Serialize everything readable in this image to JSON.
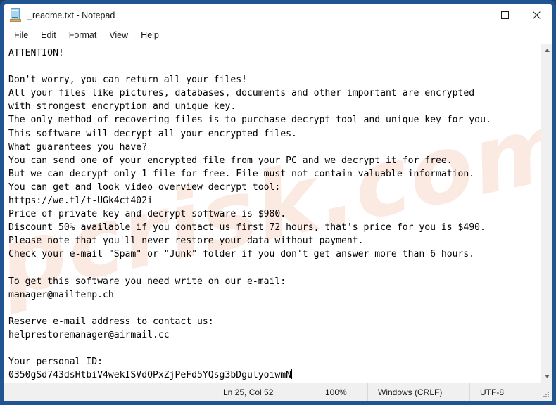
{
  "window": {
    "title": "_readme.txt - Notepad",
    "icon": "notepad-icon",
    "controls": {
      "minimize": "Minimize",
      "maximize": "Maximize",
      "close": "Close"
    },
    "border_color": "#205493"
  },
  "menu": {
    "items": [
      {
        "label": "File"
      },
      {
        "label": "Edit"
      },
      {
        "label": "Format"
      },
      {
        "label": "View"
      },
      {
        "label": "Help"
      }
    ]
  },
  "editor": {
    "watermark": "pcrisk.com",
    "content": "ATTENTION!\n\nDon't worry, you can return all your files!\nAll your files like pictures, databases, documents and other important are encrypted\nwith strongest encryption and unique key.\nThe only method of recovering files is to purchase decrypt tool and unique key for you.\nThis software will decrypt all your encrypted files.\nWhat guarantees you have?\nYou can send one of your encrypted file from your PC and we decrypt it for free.\nBut we can decrypt only 1 file for free. File must not contain valuable information.\nYou can get and look video overview decrypt tool:\nhttps://we.tl/t-UGk4ct402i\nPrice of private key and decrypt software is $980.\nDiscount 50% available if you contact us first 72 hours, that's price for you is $490.\nPlease note that you'll never restore your data without payment.\nCheck your e-mail \"Spam\" or \"Junk\" folder if you don't get answer more than 6 hours.\n\nTo get this software you need write on our e-mail:\nmanager@mailtemp.ch\n\nReserve e-mail address to contact us:\nhelprestoremanager@airmail.cc\n\nYour personal ID:\n0350gSd743dsHtbiV4wekISVdQPxZjPeFd5YQsg3bDgulyoiwmN",
    "details": {
      "video_url": "https://we.tl/t-UGk4ct402i",
      "price": "$980",
      "discount_price": "$490",
      "discount_percent": "50%",
      "discount_window": "72 hours",
      "response_time": "6 hours",
      "primary_email": "manager@mailtemp.ch",
      "reserve_email": "helprestoremanager@airmail.cc",
      "personal_id": "0350gSd743dsHtbiV4wekISVdQPxZjPeFd5YQsg3bDgulyoiwmN"
    }
  },
  "scrollbar": {
    "up_arrow": "scroll-up-icon",
    "down_arrow": "scroll-down-icon"
  },
  "statusbar": {
    "position": "Ln 25, Col 52",
    "zoom": "100%",
    "line_ending": "Windows (CRLF)",
    "encoding": "UTF-8"
  }
}
